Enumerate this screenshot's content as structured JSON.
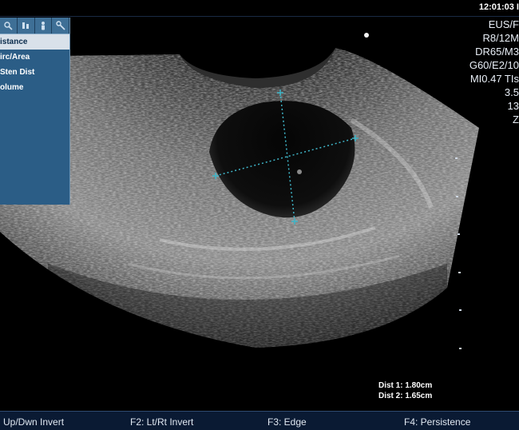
{
  "header": {
    "clock": "12:01:03 I"
  },
  "menu": {
    "tabs": [
      {
        "icon": "magnifier-icon"
      },
      {
        "icon": "tools-icon"
      },
      {
        "icon": "person-icon"
      },
      {
        "icon": "wrench-icon"
      }
    ],
    "items": [
      {
        "label": "istance",
        "selected": true
      },
      {
        "label": "irc/Area",
        "selected": false
      },
      {
        "label": "  Sten Dist",
        "selected": false
      },
      {
        "label": "olume",
        "selected": false
      }
    ]
  },
  "info_panel": {
    "lines": [
      "EUS/F",
      "R8/12M",
      "DR65/M3",
      "G60/E2/10",
      "MI0.47  TIs",
      "3.5",
      "13",
      "Z"
    ]
  },
  "measurements": {
    "dist1": "Dist 1: 1.80cm",
    "dist2": "Dist 2: 1.65cm"
  },
  "function_keys": {
    "f1": "Up/Dwn Invert",
    "f2": "F2:  Lt/Rt Invert",
    "f3": "F3:  Edge",
    "f4": "F4:  Persistence"
  },
  "colors": {
    "menu_bg": "#2b5d86",
    "menu_selected_bg": "#d9e1ea",
    "bottom_bar_bg": "#0a1a33",
    "caliper_color": "#3fb5c8"
  }
}
